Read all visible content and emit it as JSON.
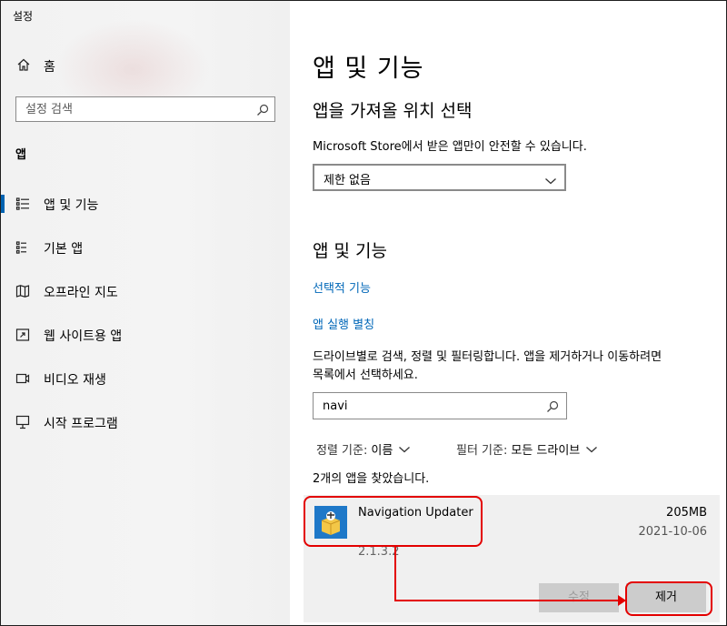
{
  "window": {
    "title": "설정"
  },
  "sidebar": {
    "home_label": "홈",
    "search_placeholder": "설정 검색",
    "section_label": "앱",
    "items": [
      {
        "label": "앱 및 기능",
        "icon": "apps-features-icon",
        "active": true
      },
      {
        "label": "기본 앱",
        "icon": "default-apps-icon",
        "active": false
      },
      {
        "label": "오프라인 지도",
        "icon": "offline-maps-icon",
        "active": false
      },
      {
        "label": "웹 사이트용 앱",
        "icon": "apps-for-websites-icon",
        "active": false
      },
      {
        "label": "비디오 재생",
        "icon": "video-playback-icon",
        "active": false
      },
      {
        "label": "시작 프로그램",
        "icon": "startup-icon",
        "active": false
      }
    ]
  },
  "main": {
    "title": "앱 및 기능",
    "install_section": {
      "heading": "앱을 가져올 위치 선택",
      "description": "Microsoft Store에서 받은 앱만이 안전할 수 있습니다.",
      "dropdown_value": "제한 없음"
    },
    "apps_section": {
      "heading": "앱 및 기능",
      "link_optional": "선택적 기능",
      "link_aliases": "앱 실행 별칭",
      "instructions_line1": "드라이브별로 검색, 정렬 및 필터링합니다. 앱을 제거하거나 이동하려면",
      "instructions_line2": "목록에서 선택하세요.",
      "search_value": "navi",
      "sort_label": "정렬 기준:",
      "sort_value": "이름",
      "filter_label": "필터 기준:",
      "filter_value": "모든 드라이브",
      "result_count": "2개의 앱을 찾았습니다."
    },
    "app_item": {
      "name": "Navigation Updater",
      "size": "205MB",
      "date": "2021-10-06",
      "version": "2.1.3.2",
      "modify_label": "수정",
      "uninstall_label": "제거"
    }
  },
  "colors": {
    "accent": "#0063b1",
    "link": "#0067b8",
    "annotation": "#e30000",
    "app_icon_bg": "#1e78c8"
  }
}
